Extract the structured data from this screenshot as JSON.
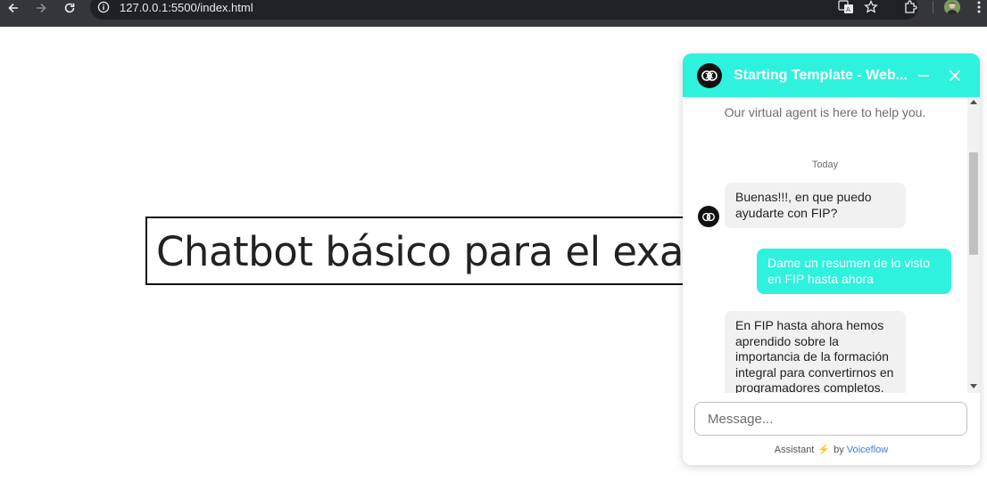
{
  "browser": {
    "url": "127.0.0.1:5500/index.html"
  },
  "page": {
    "heading": "Chatbot básico para el examen"
  },
  "chat": {
    "title": "Starting Template - Web...",
    "tagline": "Our virtual agent is here to help you.",
    "date_label": "Today",
    "messages": [
      {
        "role": "assistant",
        "text": "Buenas!!!, en que puedo ayudarte con FIP?"
      },
      {
        "role": "user",
        "text": "Dame un resumen de lo visto en FIP hasta ahora"
      },
      {
        "role": "assistant",
        "text": "En FIP hasta ahora hemos aprendido sobre la importancia de la formación integral para convertirnos en programadores completos."
      }
    ],
    "input_placeholder": "Message...",
    "footer": {
      "assistant_label": "Assistant",
      "by_label": "by",
      "brand": "Voiceflow"
    },
    "accent_color": "#2ef2dd"
  }
}
